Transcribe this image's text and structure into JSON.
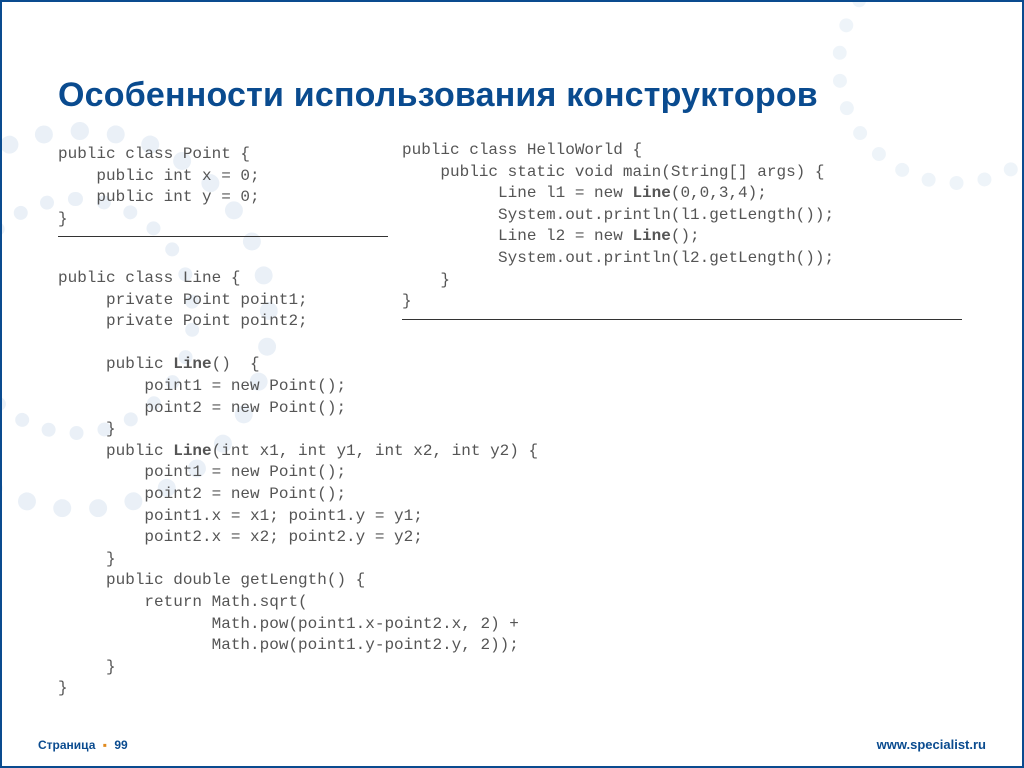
{
  "title": "Особенности использования конструкторов",
  "code": {
    "point_class": "public class Point {\n    public int x = 0;\n    public int y = 0;\n}",
    "line_class": {
      "l0": "public class Line {",
      "l1": "     private Point point1;",
      "l2": "     private Point point2;",
      "l3": "",
      "l4a": "     public ",
      "l4b": "Line",
      "l4c": "()  {",
      "l5": "         point1 = new Point();",
      "l6": "         point2 = new Point();",
      "l7": "     }",
      "l8a": "     public ",
      "l8b": "Line",
      "l8c": "(int x1, int y1, int x2, int y2) {",
      "l9": "         point1 = new Point();",
      "l10": "         point2 = new Point();",
      "l11": "         point1.x = x1; point1.y = y1;",
      "l12": "         point2.x = x2; point2.y = y2;",
      "l13": "     }",
      "l14": "     public double getLength() {",
      "l15": "         return Math.sqrt(",
      "l16": "                Math.pow(point1.x-point2.x, 2) +",
      "l17": "                Math.pow(point1.y-point2.y, 2));",
      "l18": "     }",
      "l19": "}"
    },
    "hello_world": {
      "h0": "public class HelloWorld {",
      "h1": "    public static void main(String[] args) {",
      "h2a": "          Line l1 = new ",
      "h2b": "Line",
      "h2c": "(0,0,3,4);",
      "h3": "          System.out.println(l1.getLength());",
      "h4a": "          Line l2 = new ",
      "h4b": "Line",
      "h4c": "();",
      "h5": "          System.out.println(l2.getLength());",
      "h6": "    }",
      "h7": "}"
    }
  },
  "footer": {
    "page_label": "Страница",
    "page_number": "99",
    "url": "www.specialist.ru"
  }
}
